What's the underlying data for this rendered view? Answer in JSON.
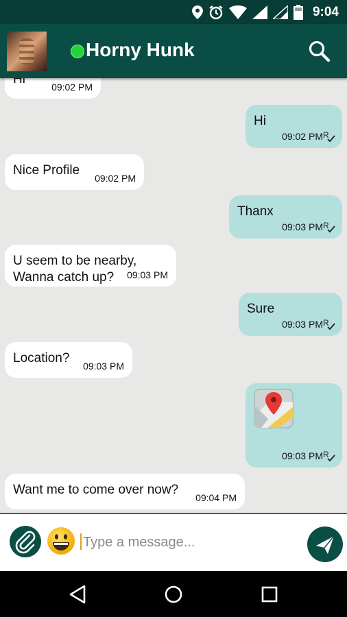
{
  "status_bar": {
    "time": "9:04",
    "icons": [
      "location-icon",
      "alarm-icon",
      "wifi-icon",
      "signal-icon",
      "signal-icon",
      "battery-icon"
    ]
  },
  "header": {
    "contact_name": "Horny Hunk",
    "online": true,
    "online_color": "#22d63a"
  },
  "colors": {
    "app_bar": "#0a4d45",
    "status_bar": "#073d36",
    "incoming_bubble": "#ffffff",
    "outgoing_bubble": "#b3dfdc",
    "chat_background": "#e8e8e6"
  },
  "messages": [
    {
      "direction": "in",
      "text": "Hi",
      "time": "09:02 PM"
    },
    {
      "direction": "out",
      "text": "Hi",
      "time": "09:02 PM",
      "receipt": "R"
    },
    {
      "direction": "in",
      "text": "Nice Profile",
      "time": "09:02 PM"
    },
    {
      "direction": "out",
      "text": "Thanx",
      "time": "09:03 PM",
      "receipt": "R"
    },
    {
      "direction": "in",
      "text": "U seem to be nearby,\nWanna catch up?",
      "time": "09:03 PM"
    },
    {
      "direction": "out",
      "text": "Sure",
      "time": "09:03 PM",
      "receipt": "R"
    },
    {
      "direction": "in",
      "text": "Location?",
      "time": "09:03 PM"
    },
    {
      "direction": "out",
      "type": "location",
      "icon": "map-pin-icon",
      "time": "09:03 PM",
      "receipt": "R"
    },
    {
      "direction": "in",
      "text": "Want me to come over now?",
      "time": "09:04 PM"
    }
  ],
  "composer": {
    "placeholder": "Type a message...",
    "value": ""
  },
  "nav": [
    "back",
    "home",
    "recents"
  ]
}
